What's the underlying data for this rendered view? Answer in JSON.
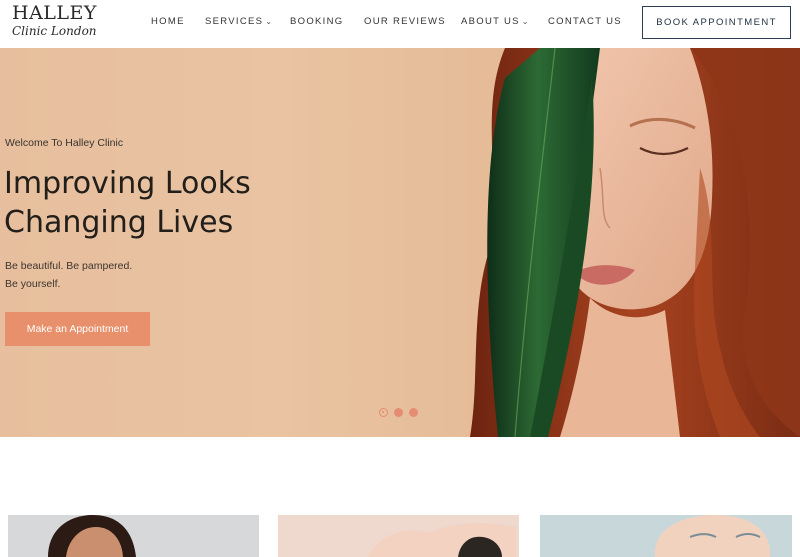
{
  "header": {
    "logo_line1": "HALLEY",
    "logo_line2": "Clinic London",
    "nav": [
      {
        "label": "HOME",
        "dropdown": false
      },
      {
        "label": "SERVICES",
        "dropdown": true
      },
      {
        "label": "BOOKING",
        "dropdown": false
      },
      {
        "label": "OUR REVIEWS",
        "dropdown": false
      },
      {
        "label": "ABOUT US",
        "dropdown": true
      },
      {
        "label": "CONTACT US",
        "dropdown": false
      }
    ],
    "book_button": "BOOK APPOINTMENT",
    "chevron_glyph": "⌄"
  },
  "hero": {
    "welcome": "Welcome To Halley Clinic",
    "headline_line1": "Improving Looks",
    "headline_line2": "Changing Lives",
    "tagline_line1": "Be beautiful.  Be pampered.",
    "tagline_line2": "Be yourself.",
    "cta_label": "Make an Appointment",
    "slides_total": 3,
    "active_slide": 1
  },
  "colors": {
    "accent": "#e8906b",
    "hero_bg": "#e7bf9e",
    "button_border": "#2d3f52"
  },
  "cards": [
    {
      "id": "card-1"
    },
    {
      "id": "card-2"
    },
    {
      "id": "card-3"
    }
  ]
}
